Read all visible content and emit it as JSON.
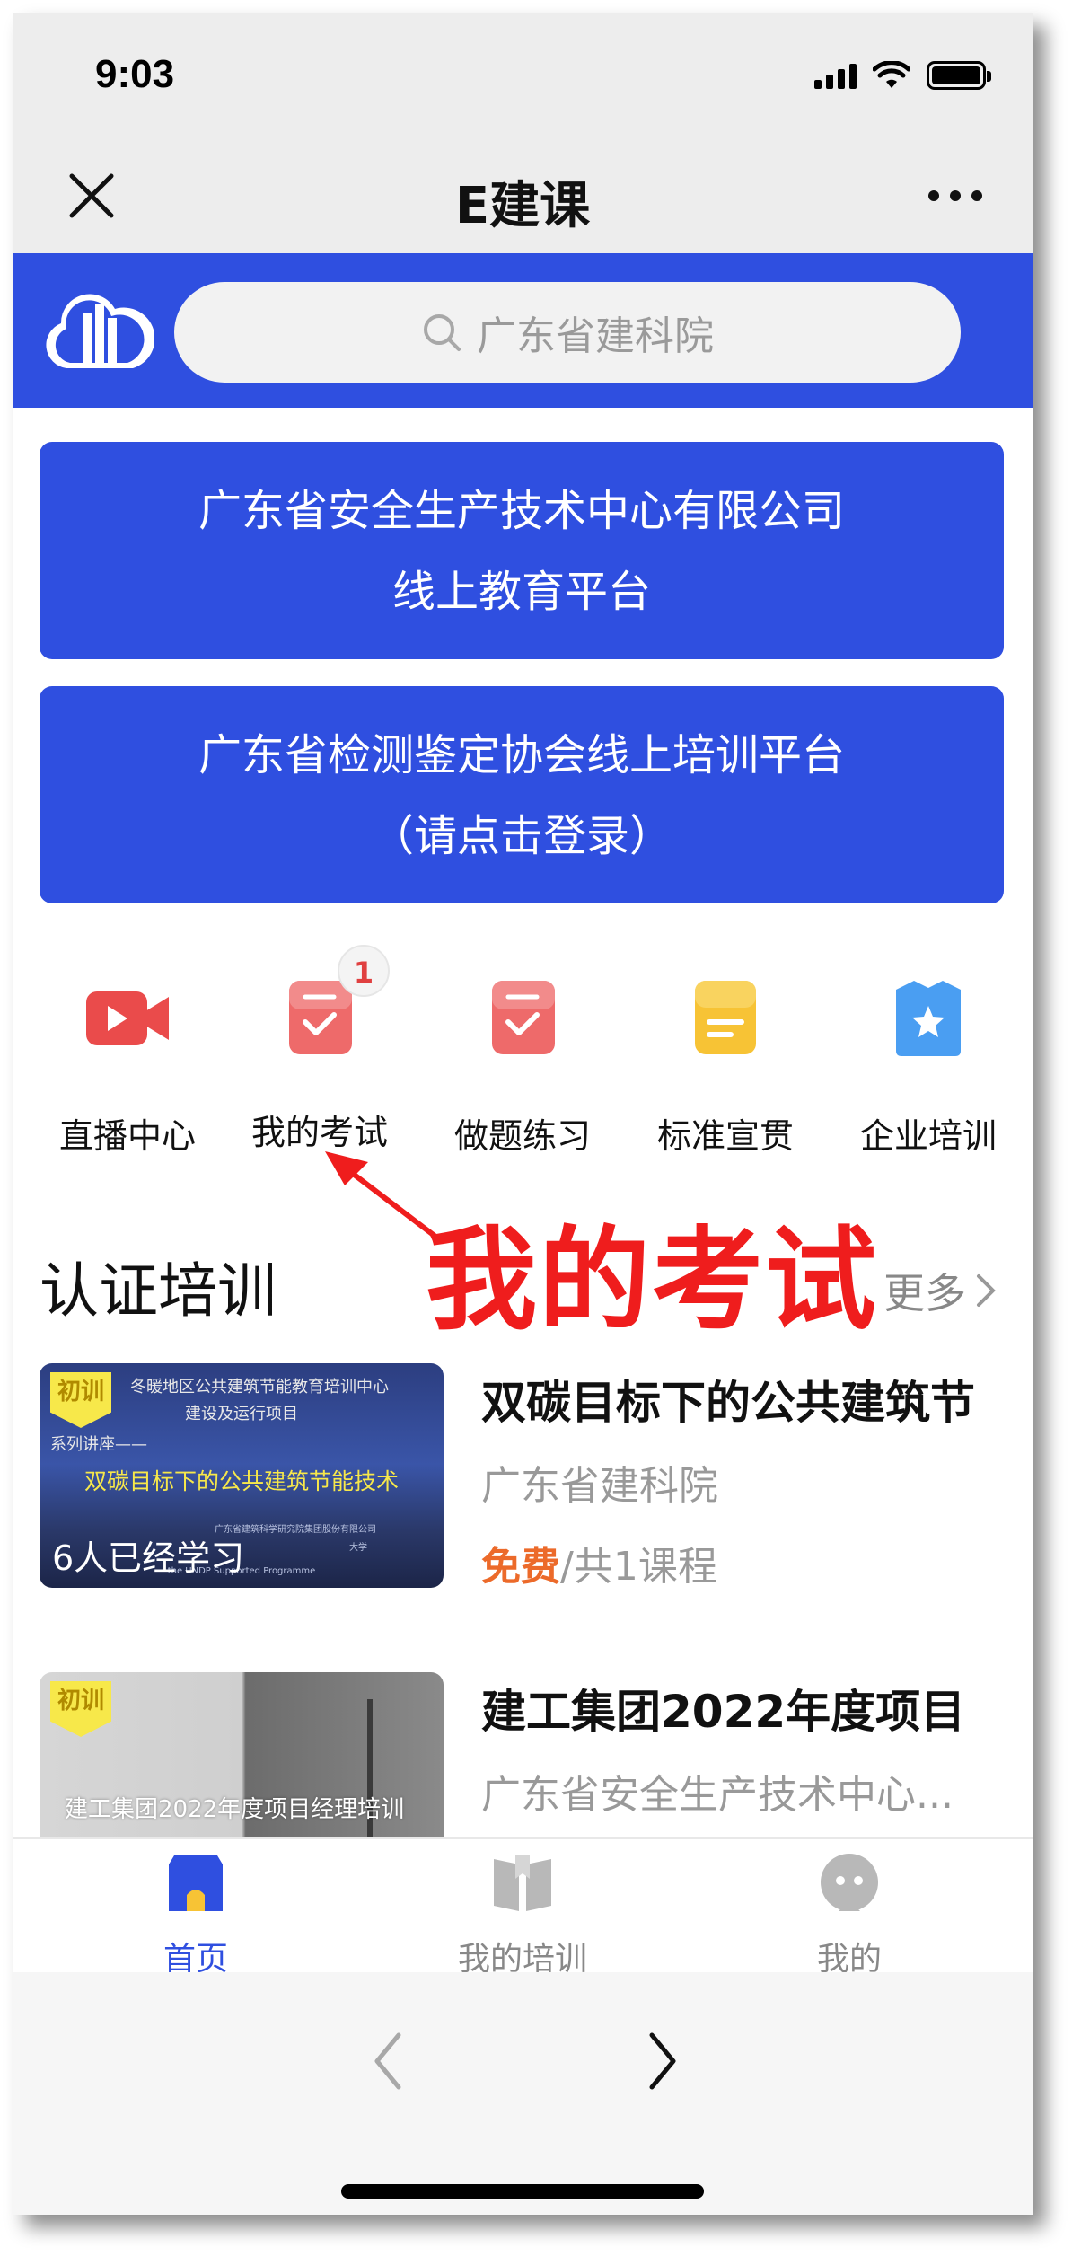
{
  "status_bar": {
    "time": "9:03"
  },
  "nav": {
    "title": "E建课"
  },
  "search": {
    "placeholder": "广东省建科院"
  },
  "banners": [
    {
      "line1": "广东省安全生产技术中心有限公司",
      "line2": "线上教育平台"
    },
    {
      "line1": "广东省检测鉴定协会线上培训平台",
      "line2": "（请点击登录）"
    }
  ],
  "quick_menu": [
    {
      "label": "直播中心",
      "icon": "video-camera-icon"
    },
    {
      "label": "我的考试",
      "icon": "exam-check-icon",
      "badge": "1"
    },
    {
      "label": "做题练习",
      "icon": "practice-check-icon"
    },
    {
      "label": "标准宣贯",
      "icon": "document-icon"
    },
    {
      "label": "企业培训",
      "icon": "star-bag-icon"
    }
  ],
  "annotation": {
    "text": "我的考试"
  },
  "section": {
    "title": "认证培训",
    "more_label": "更多"
  },
  "courses": [
    {
      "tag": "初训",
      "thumb_line1": "冬暖地区公共建筑节能教育培训中心",
      "thumb_line2": "建设及运行项目",
      "thumb_series": "系列讲座——",
      "thumb_headline": "双碳目标下的公共建筑节能技术",
      "thumb_org": "广东省建筑科学研究院集团股份有限公司",
      "thumb_univ": "大学",
      "thumb_program": "the UNDP Supported Programme",
      "learners": "6人已经学习",
      "title": "双碳目标下的公共建筑节",
      "org": "广东省建科院",
      "price_free": "免费",
      "price_count": "/共1课程"
    },
    {
      "tag": "初训",
      "thumb_caption": "建工集团2022年度项目经理培训",
      "title": "建工集团2022年度项目",
      "org": "广东省安全生产技术中心..."
    }
  ],
  "tab_bar": [
    {
      "label": "首页",
      "icon": "home-icon",
      "active": true
    },
    {
      "label": "我的培训",
      "icon": "book-icon",
      "active": false
    },
    {
      "label": "我的",
      "icon": "profile-face-icon",
      "active": false
    }
  ],
  "colors": {
    "brand_blue": "#2f4fe0",
    "annotation_red": "#ef1d1d",
    "price_orange": "#ec6a2a"
  }
}
